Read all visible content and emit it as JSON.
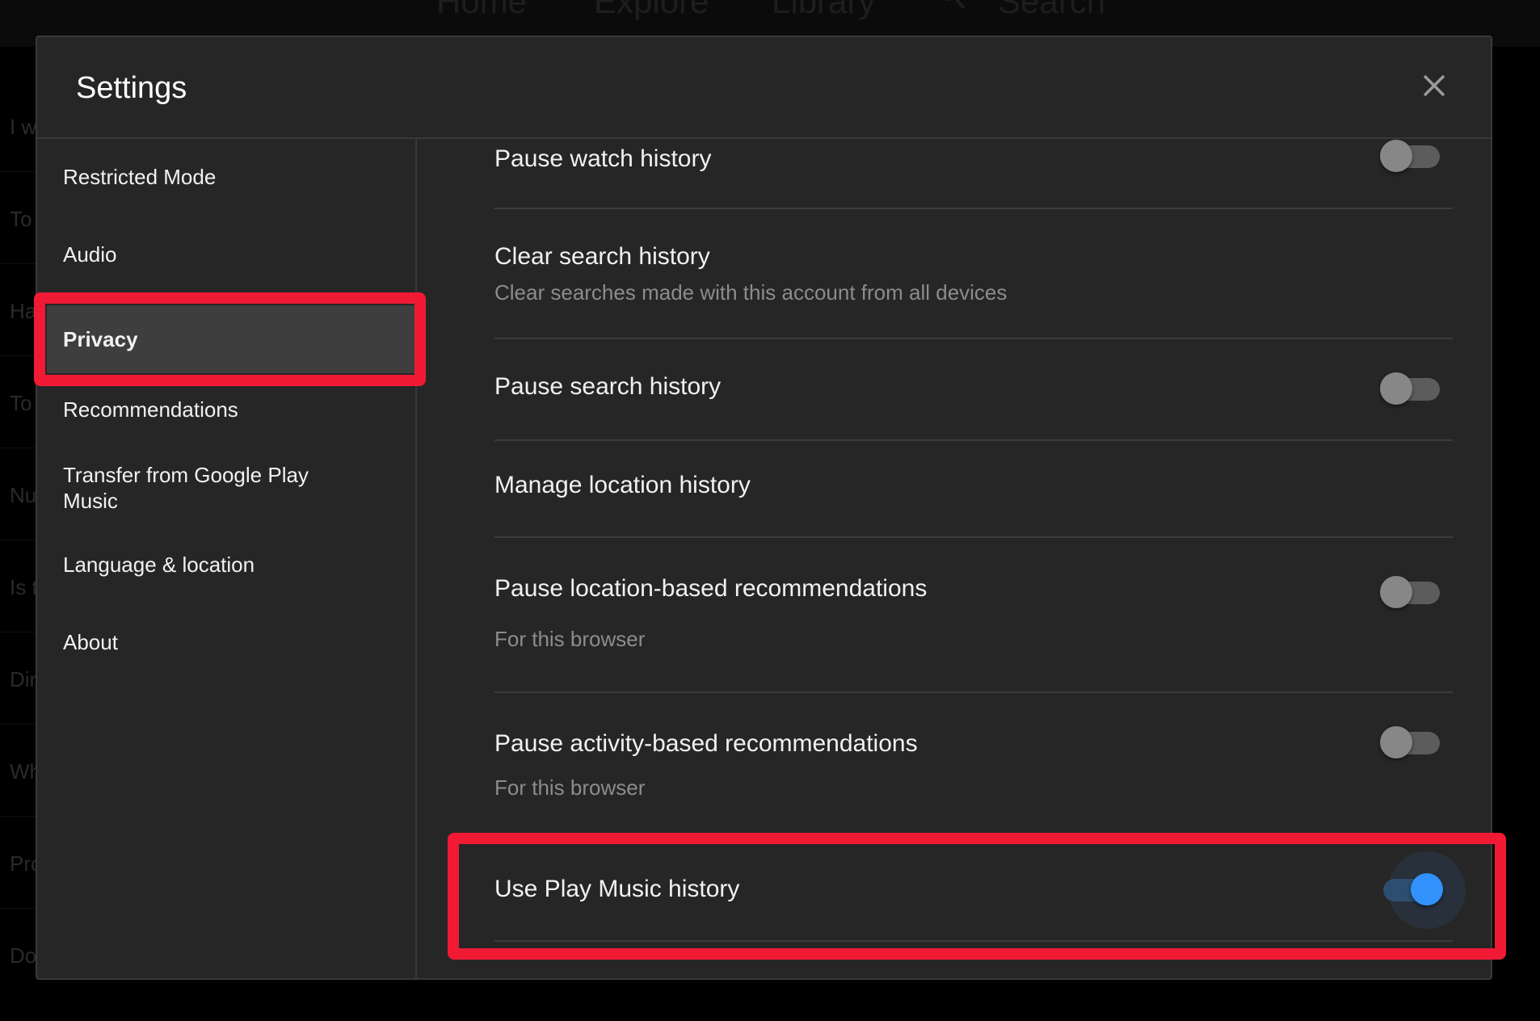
{
  "topnav": {
    "items": [
      "Home",
      "Explore",
      "Library",
      "Search"
    ]
  },
  "background_list": [
    "I w",
    "To",
    "Ha",
    "To",
    "Nu",
    "Is t",
    "Dir",
    "Wh",
    "Pro",
    "Do"
  ],
  "modal": {
    "title": "Settings",
    "close_icon": "close-icon"
  },
  "sidebar": {
    "items": [
      {
        "label": "Restricted Mode"
      },
      {
        "label": "Audio"
      },
      {
        "label": "Privacy",
        "active": true
      },
      {
        "label": "Recommendations"
      },
      {
        "label_line1": "Transfer from Google Play",
        "label_line2": "Music"
      },
      {
        "label": "Language & location"
      },
      {
        "label": "About"
      }
    ]
  },
  "privacy": {
    "rows": [
      {
        "title": "Pause watch history",
        "toggle": false
      },
      {
        "title": "Clear search history",
        "subtitle": "Clear searches made with this account from all devices"
      },
      {
        "title": "Pause search history",
        "toggle": false
      },
      {
        "title": "Manage location history"
      },
      {
        "title": "Pause location-based recommendations",
        "subtitle": "For this browser",
        "toggle": false
      },
      {
        "title": "Pause activity-based recommendations",
        "subtitle": "For this browser",
        "toggle": false
      },
      {
        "title": "Use Play Music history",
        "toggle": true
      }
    ]
  },
  "colors": {
    "highlight": "#f01a35",
    "toggle_on": "#3291fb",
    "toggle_off": "#878787",
    "modal_bg": "#262626"
  }
}
